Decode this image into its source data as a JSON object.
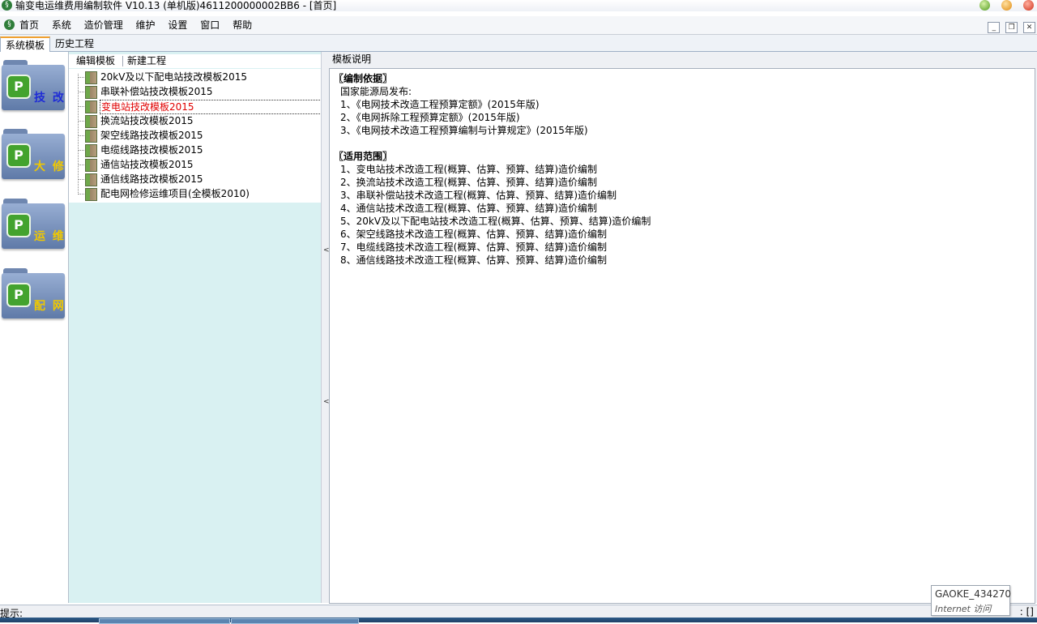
{
  "window": {
    "title": "输变电运维费用编制软件 V10.13 (单机版)4611200000002BB6 - [首页]"
  },
  "menu": {
    "items": [
      "首页",
      "系统",
      "造价管理",
      "维护",
      "设置",
      "窗口",
      "帮助"
    ]
  },
  "tabs": [
    "系统模板",
    "历史工程"
  ],
  "categories": [
    {
      "label": "技 改",
      "color": "#1e2bd6",
      "icon": "p-logo-icon"
    },
    {
      "label": "大 修",
      "color": "#f0c800",
      "icon": "p-logo-icon"
    },
    {
      "label": "运 维",
      "color": "#f0c800",
      "icon": "p-logo-icon"
    },
    {
      "label": "配 网",
      "color": "#f0c800",
      "icon": "p-logo-icon"
    }
  ],
  "tree_toolbar": {
    "edit_template": "编辑模板",
    "new_project": "新建工程"
  },
  "templates": [
    "20kV及以下配电站技改模板2015",
    "串联补偿站技改模板2015",
    "变电站技改模板2015",
    "换流站技改模板2015",
    "架空线路技改模板2015",
    "电缆线路技改模板2015",
    "通信站技改模板2015",
    "通信线路技改模板2015",
    "配电网检修运维项目(全模板2010)"
  ],
  "selected_template_index": 2,
  "description": {
    "header": "模板说明",
    "basis_title": "〖编制依据〗",
    "basis_lines": [
      "国家能源局发布:",
      "1、《电网技术改造工程预算定额》(2015年版)",
      "2、《电网拆除工程预算定额》(2015年版)",
      "3、《电网技术改造工程预算编制与计算规定》(2015年版)"
    ],
    "scope_title": "〖适用范围〗",
    "scope_lines": [
      "1、变电站技术改造工程(概算、估算、预算、结算)造价编制",
      "2、换流站技术改造工程(概算、估算、预算、结算)造价编制",
      "3、串联补偿站技术改造工程(概算、估算、预算、结算)造价编制",
      "4、通信站技术改造工程(概算、估算、预算、结算)造价编制",
      "5、20kV及以下配电站技术改造工程(概算、估算、预算、结算)造价编制",
      "6、架空线路技术改造工程(概算、估算、预算、结算)造价编制",
      "7、电缆线路技术改造工程(概算、估算、预算、结算)造价编制",
      "8、通信线路技术改造工程(概算、估算、预算、结算)造价编制"
    ]
  },
  "status": {
    "label": "提示:",
    "right": ": []"
  },
  "tooltip": {
    "title": "GAOKE_434270",
    "subtitle": "Internet 访问"
  }
}
